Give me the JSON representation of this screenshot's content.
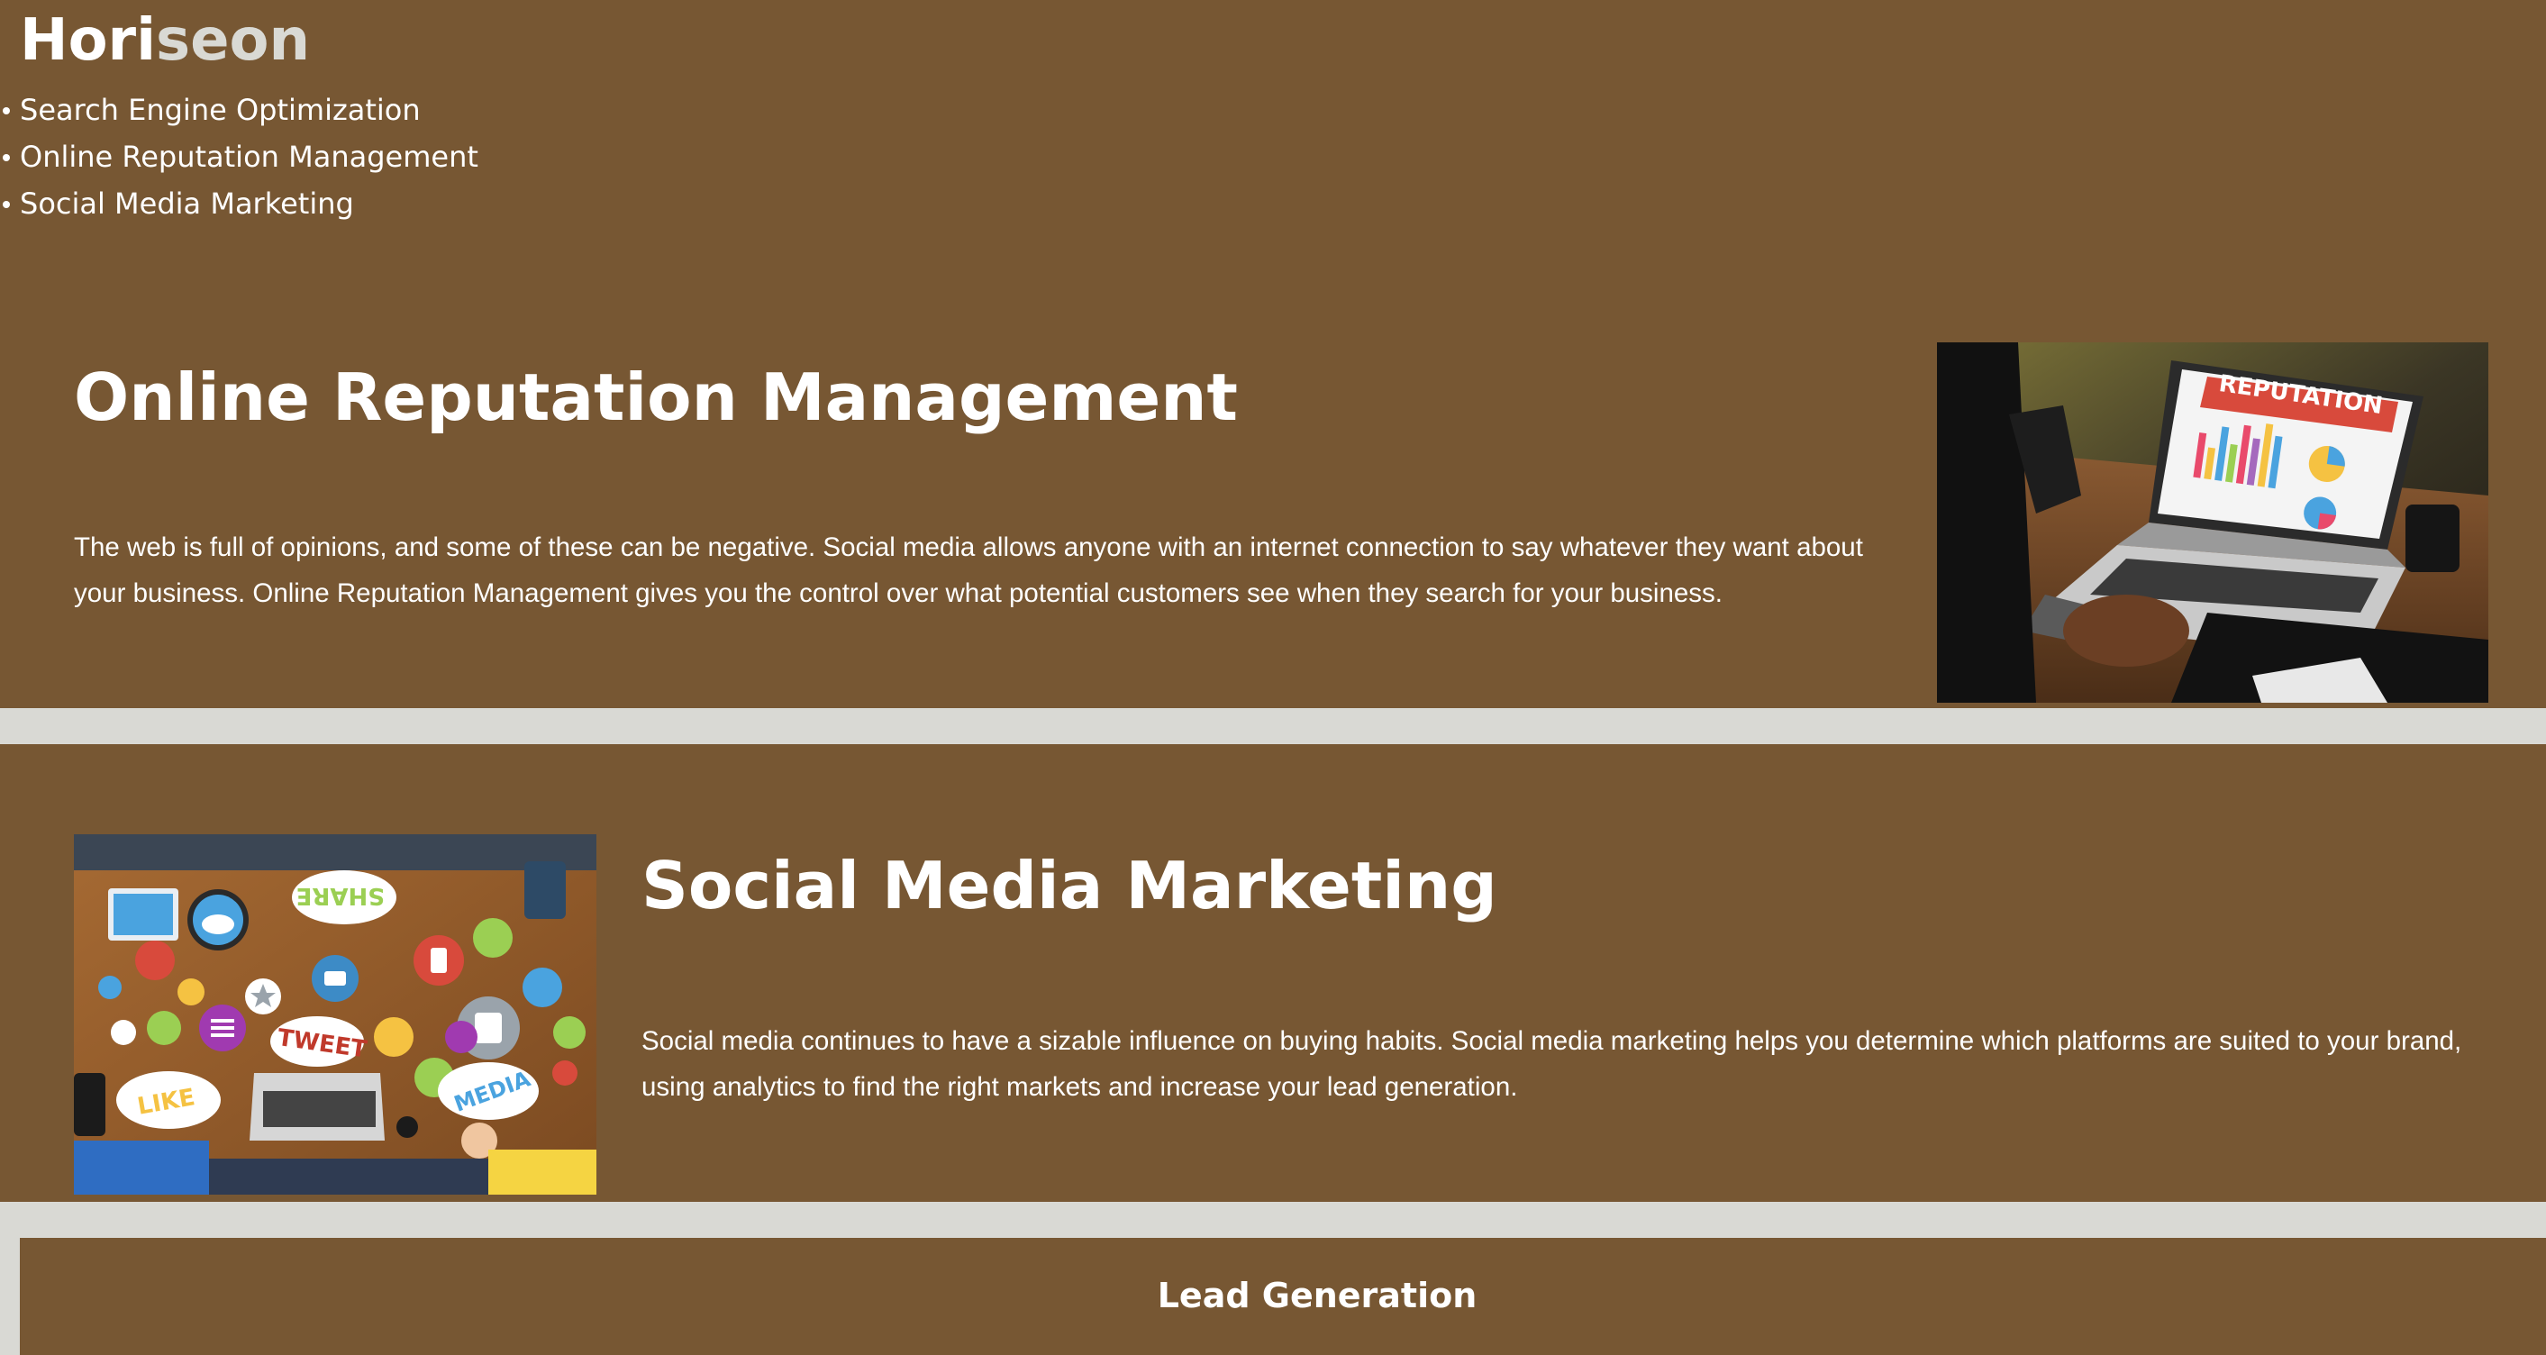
{
  "header": {
    "logo_main": "Hori",
    "logo_accent": "seon",
    "nav": [
      {
        "label": "Search Engine Optimization"
      },
      {
        "label": "Online Reputation Management"
      },
      {
        "label": "Social Media Marketing"
      }
    ]
  },
  "sections": [
    {
      "title": "Online Reputation Management",
      "body": "The web is full of opinions, and some of these can be negative. Social media allows anyone with an internet connection to say whatever they want about your business. Online Reputation Management gives you the control over what potential customers see when they search for your business.",
      "image_text": "REPUTATION"
    },
    {
      "title": "Social Media Marketing",
      "body": "Social media continues to have a sizable influence on buying habits. Social media marketing helps you determine which platforms are suited to your brand, using analytics to find the right markets and increase your lead generation.",
      "image_words": [
        "SHARE",
        "TWEET",
        "LIKE",
        "MEDIA"
      ]
    }
  ],
  "lead": {
    "title": "Lead Generation"
  },
  "colors": {
    "primary": "#775733",
    "background": "#d9d9d4",
    "text": "#ffffff"
  }
}
